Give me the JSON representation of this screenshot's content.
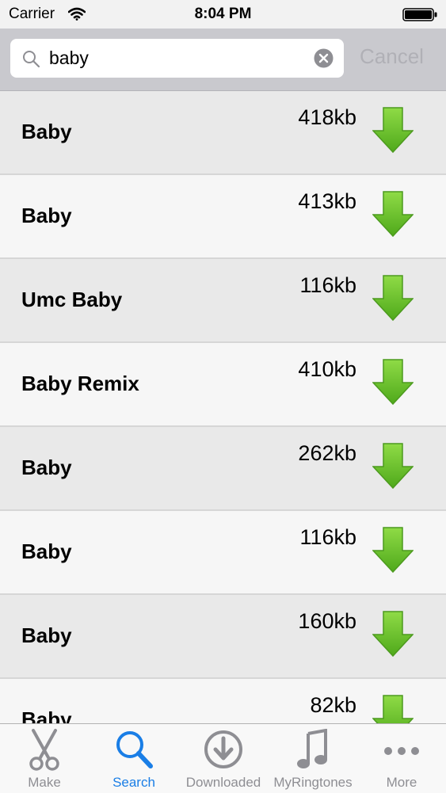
{
  "status_bar": {
    "carrier": "Carrier",
    "time": "8:04 PM"
  },
  "search": {
    "query": "baby",
    "cancel_label": "Cancel"
  },
  "results": [
    {
      "title": "Baby",
      "size": "418kb"
    },
    {
      "title": "Baby",
      "size": "413kb"
    },
    {
      "title": "Umc Baby",
      "size": "116kb"
    },
    {
      "title": "Baby Remix",
      "size": "410kb"
    },
    {
      "title": "Baby",
      "size": "262kb"
    },
    {
      "title": "Baby",
      "size": "116kb"
    },
    {
      "title": "Baby",
      "size": "160kb"
    },
    {
      "title": "Baby",
      "size": "82kb"
    }
  ],
  "tabs": [
    {
      "label": "Make",
      "icon": "scissors-icon"
    },
    {
      "label": "Search",
      "icon": "search-icon",
      "active": true
    },
    {
      "label": "Downloaded",
      "icon": "download-circle-icon"
    },
    {
      "label": "MyRingtones",
      "icon": "music-note-icon"
    },
    {
      "label": "More",
      "icon": "more-dots-icon"
    }
  ],
  "colors": {
    "accent": "#1a7ee6",
    "download_green": "#6cc72a",
    "inactive": "#8e8e93"
  }
}
